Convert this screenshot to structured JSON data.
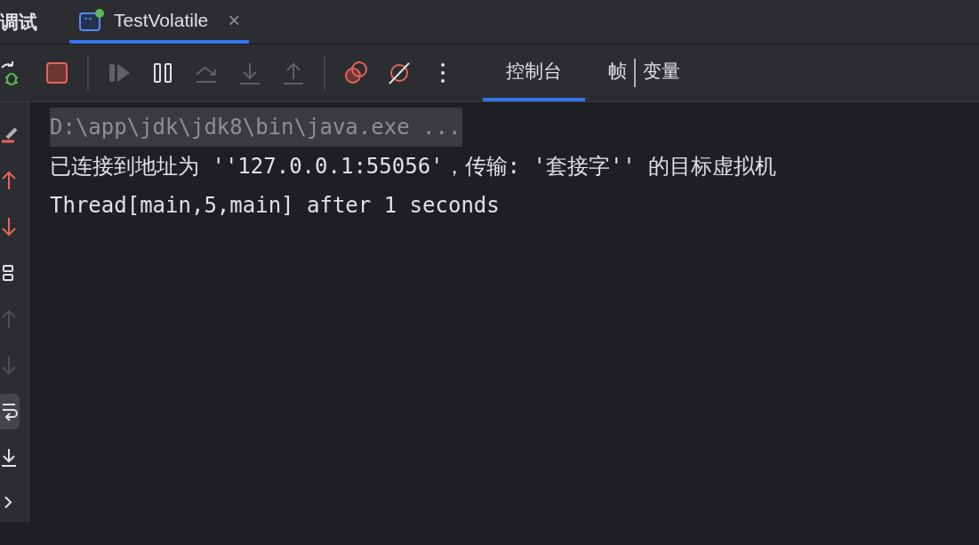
{
  "tool_window": {
    "title": "调试"
  },
  "session_tabs": [
    {
      "label": "TestVolatile",
      "selected": true,
      "running": true,
      "close_label": "×"
    }
  ],
  "toolbar": [
    {
      "kind": "rerun",
      "disabled": false
    },
    {
      "kind": "stop",
      "disabled": false
    },
    {
      "kind": "separator"
    },
    {
      "kind": "resume",
      "disabled": true
    },
    {
      "kind": "pause",
      "disabled": false
    },
    {
      "kind": "step-over",
      "disabled": true
    },
    {
      "kind": "step-into",
      "disabled": true
    },
    {
      "kind": "step-out",
      "disabled": true
    },
    {
      "kind": "separator"
    },
    {
      "kind": "breakpoints",
      "disabled": false
    },
    {
      "kind": "mute-breakpoints",
      "disabled": false
    },
    {
      "kind": "more",
      "disabled": false
    }
  ],
  "view_tabs": [
    {
      "label": "控制台",
      "selected": true
    },
    {
      "label": "帧",
      "selected": false
    },
    {
      "label": "变量",
      "selected": false
    }
  ],
  "side_actions": [
    {
      "kind": "clear",
      "disabled": false,
      "selected": false
    },
    {
      "kind": "up",
      "disabled": false,
      "selected": false
    },
    {
      "kind": "down",
      "disabled": false,
      "selected": false
    },
    {
      "kind": "layout",
      "disabled": false,
      "selected": false
    },
    {
      "kind": "up",
      "disabled": true,
      "selected": false
    },
    {
      "kind": "down",
      "disabled": true,
      "selected": false
    },
    {
      "kind": "wrap",
      "disabled": false,
      "selected": true
    },
    {
      "kind": "scroll-end",
      "disabled": false,
      "selected": false
    },
    {
      "kind": "chevron",
      "disabled": false,
      "selected": false
    }
  ],
  "console": {
    "lines": [
      {
        "kind": "command",
        "text": "D:\\app\\jdk\\jdk8\\bin\\java.exe ..."
      },
      {
        "kind": "output",
        "text": "已连接到地址为 ''127.0.0.1:55056'，传输: '套接字'' 的目标虚拟机"
      },
      {
        "kind": "output",
        "text": "Thread[main,5,main] after 1 seconds"
      }
    ]
  }
}
